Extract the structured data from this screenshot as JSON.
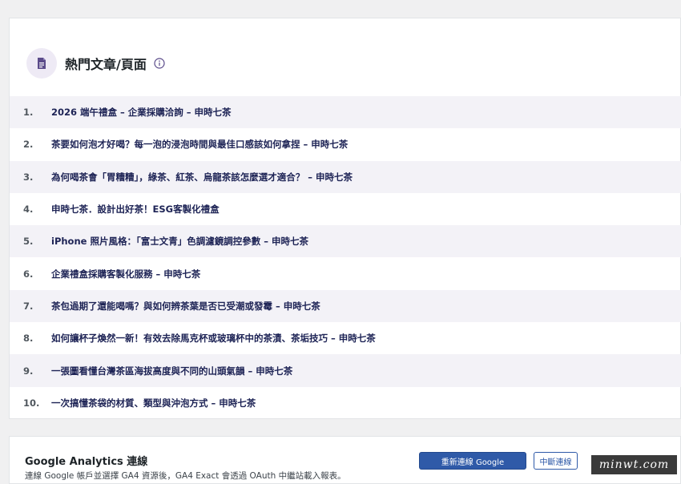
{
  "popular": {
    "title": "熱門文章/頁面",
    "items": [
      {
        "num": "1.",
        "title": "2026 端午禮盒 – 企業採購洽詢 – 申時七茶"
      },
      {
        "num": "2.",
        "title": "茶要如何泡才好喝？每一泡的浸泡時間與最佳口感該如何拿捏 – 申時七茶"
      },
      {
        "num": "3.",
        "title": "為何喝茶會「胃糟糟」，綠茶、紅茶、烏龍茶該怎麼選才適合？ – 申時七茶"
      },
      {
        "num": "4.",
        "title": "申時七茶．設計出好茶！ESG客製化禮盒"
      },
      {
        "num": "5.",
        "title": "iPhone 照片風格：「富士文青」色調濾鏡調控參數 – 申時七茶"
      },
      {
        "num": "6.",
        "title": "企業禮盒採購客製化服務 – 申時七茶"
      },
      {
        "num": "7.",
        "title": "茶包過期了還能喝嗎？與如何辨茶葉是否已受潮或發霉 – 申時七茶"
      },
      {
        "num": "8.",
        "title": "如何讓杯子煥然一新！有效去除馬克杯或玻璃杯中的茶漬、茶垢技巧 – 申時七茶"
      },
      {
        "num": "9.",
        "title": "一張圖看懂台灣茶區海拔高度與不同的山頭氣韻 – 申時七茶"
      },
      {
        "num": "10.",
        "title": "一次搞懂茶袋的材質、類型與沖泡方式 – 申時七茶"
      }
    ]
  },
  "ga": {
    "title": "Google Analytics 連線",
    "description": "連線 Google 帳戶並選擇 GA4 資源後，GA4 Exact 會透過 OAuth 中繼站載入報表。",
    "reconnect_label": "重新連線 Google",
    "disconnect_label": "中斷連線"
  },
  "watermark": "minwt.com",
  "colors": {
    "accent": "#2f5aa8",
    "row_alt": "#f3f2f7",
    "title_text": "#1d2355",
    "icon_badge": "#eeeaf5",
    "icon": "#5b4b8a"
  },
  "icons": {
    "header": "document-icon",
    "info": "info-icon"
  }
}
